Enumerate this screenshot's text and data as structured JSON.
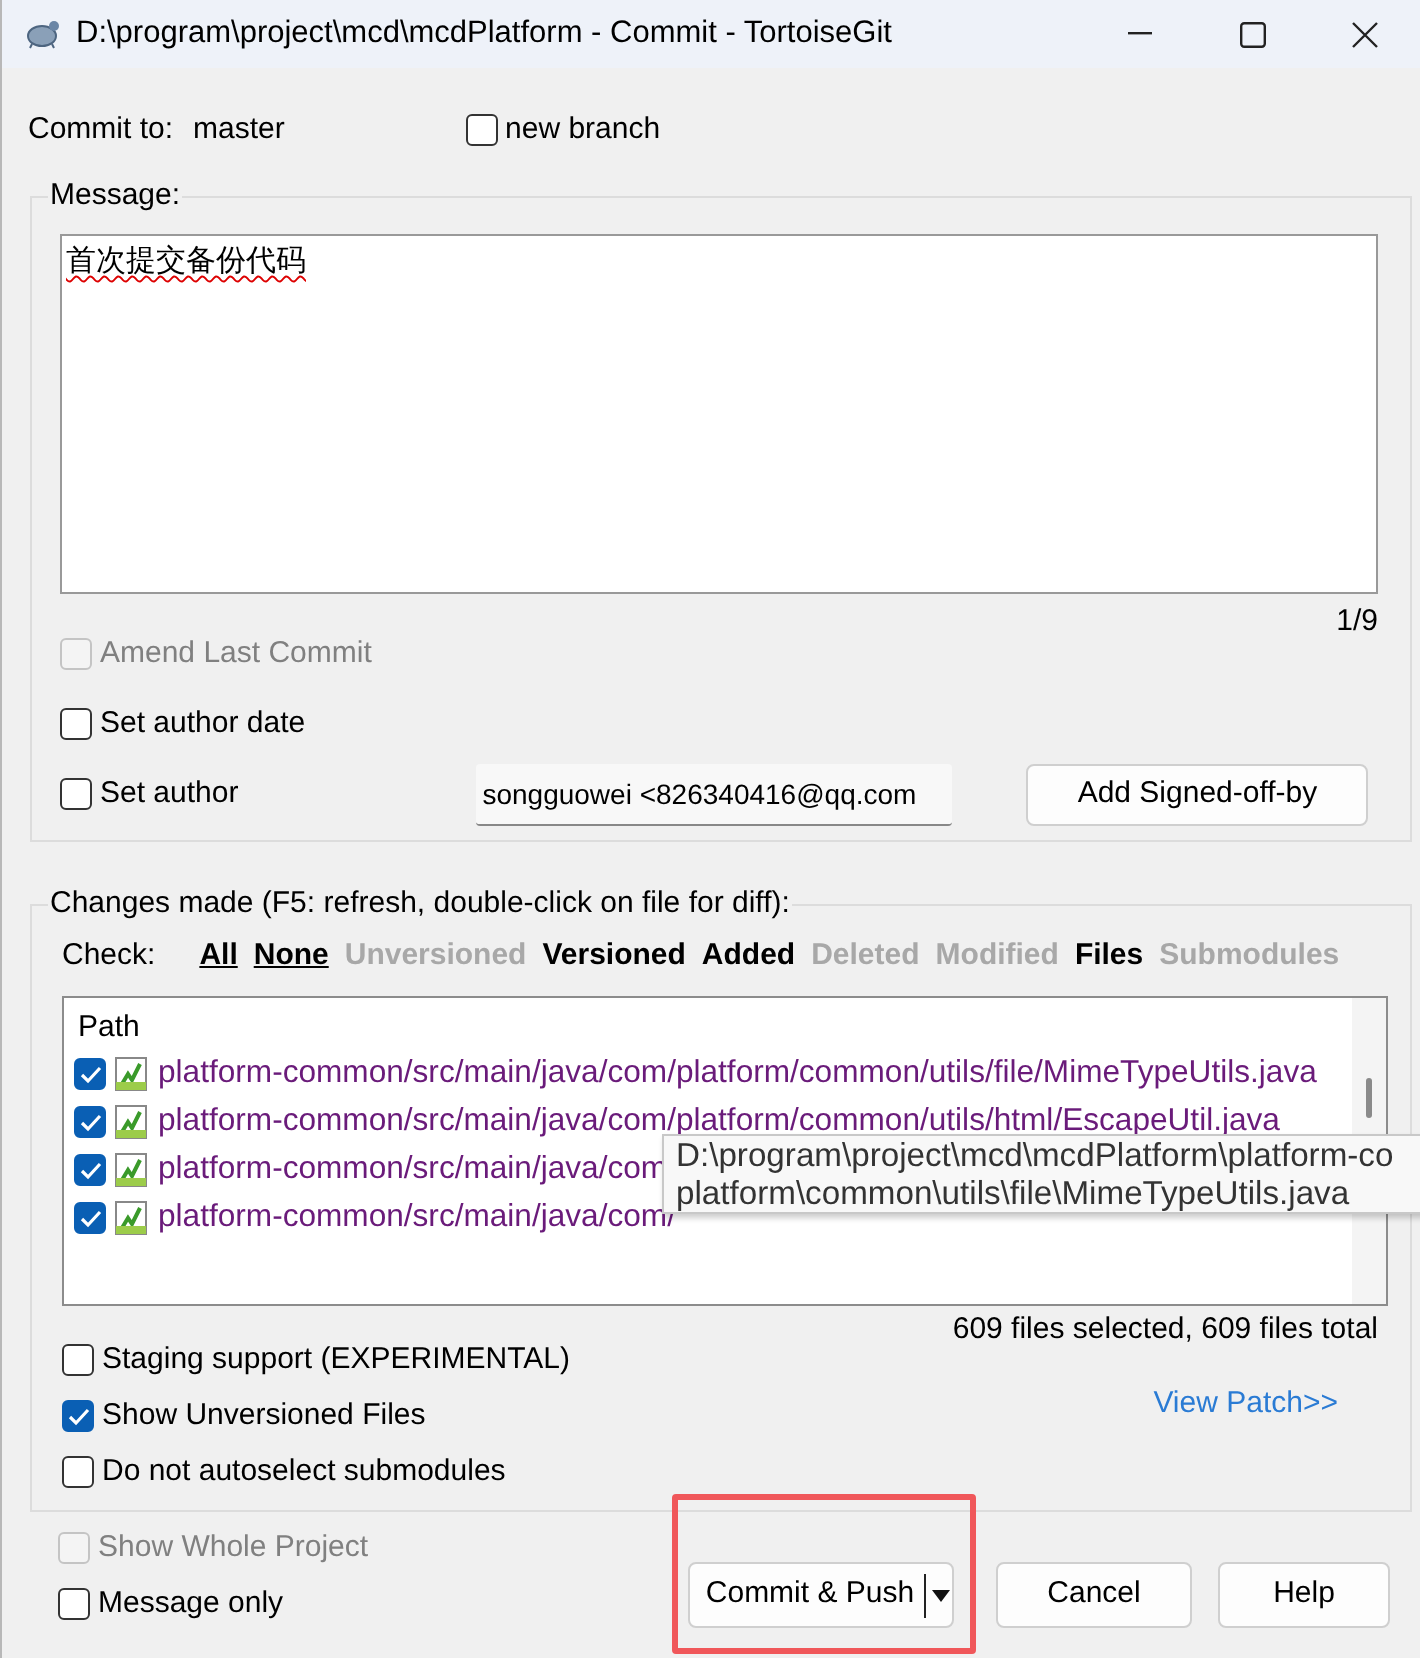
{
  "window": {
    "title": "D:\\program\\project\\mcd\\mcdPlatform - Commit - TortoiseGit"
  },
  "commit_to": {
    "label": "Commit to:",
    "branch": "master"
  },
  "new_branch": {
    "label": "new branch",
    "checked": false
  },
  "message": {
    "label": "Message:",
    "text": "首次提交备份代码",
    "counter": "1/9"
  },
  "message_options": [
    {
      "label": "Amend Last Commit",
      "checked": false,
      "disabled": true
    },
    {
      "label": "Set author date",
      "checked": false,
      "disabled": false
    },
    {
      "label": "Set author",
      "checked": false,
      "disabled": false
    }
  ],
  "author_field": {
    "value": "songguowei <826340416@qq.com"
  },
  "signoff_button": {
    "label": "Add Signed-off-by"
  },
  "changes": {
    "label": "Changes made (F5: refresh, double-click on file for diff):",
    "check_label": "Check:",
    "filters": [
      {
        "label": "All",
        "disabled": false,
        "underlined": true
      },
      {
        "label": "None",
        "disabled": false,
        "underlined": true
      },
      {
        "label": "Unversioned",
        "disabled": true,
        "underlined": false
      },
      {
        "label": "Versioned",
        "disabled": false,
        "underlined": false
      },
      {
        "label": "Added",
        "disabled": false,
        "underlined": false
      },
      {
        "label": "Deleted",
        "disabled": true,
        "underlined": false
      },
      {
        "label": "Modified",
        "disabled": true,
        "underlined": false
      },
      {
        "label": "Files",
        "disabled": false,
        "underlined": false
      },
      {
        "label": "Submodules",
        "disabled": true,
        "underlined": false
      }
    ],
    "column": "Path",
    "files": [
      {
        "path": "platform-common/src/main/java/com/platform/common/utils/file/MimeTypeUtils.java",
        "checked": true
      },
      {
        "path": "platform-common/src/main/java/com/platform/common/utils/html/EscapeUtil.java",
        "checked": true
      },
      {
        "path": "platform-common/src/main/java/com",
        "checked": true
      },
      {
        "path": "platform-common/src/main/java/com/",
        "checked": true
      }
    ],
    "tooltip": [
      "D:\\program\\project\\mcd\\mcdPlatform\\platform-co",
      "platform\\common\\utils\\file\\MimeTypeUtils.java"
    ],
    "summary": "609 files selected, 609 files total",
    "options": [
      {
        "label": "Staging support (EXPERIMENTAL)",
        "checked": false
      },
      {
        "label": "Show Unversioned Files",
        "checked": true
      },
      {
        "label": "Do not autoselect submodules",
        "checked": false
      }
    ],
    "view_patch": "View Patch>>"
  },
  "bottom_options": [
    {
      "label": "Show Whole Project",
      "checked": false,
      "disabled": true
    },
    {
      "label": "Message only",
      "checked": false,
      "disabled": false
    }
  ],
  "buttons": [
    {
      "label": "Commit & Push",
      "kind": "split",
      "highlighted": true
    },
    {
      "label": "Cancel",
      "kind": "plain"
    },
    {
      "label": "Help",
      "kind": "plain"
    }
  ]
}
